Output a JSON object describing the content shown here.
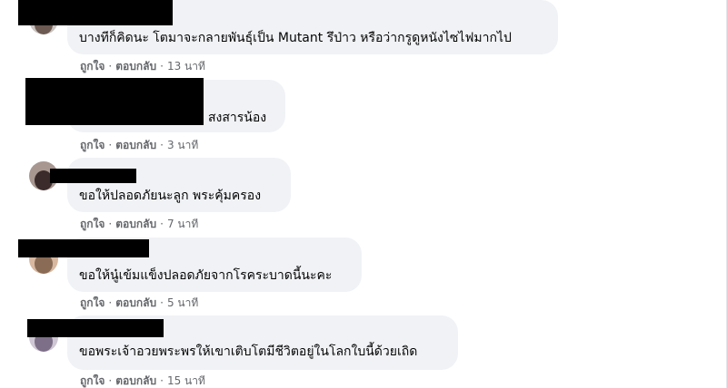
{
  "comments": [
    {
      "text": "บางทีก็คิดนะ โตมาจะกลายพันธุ์เป็น Mutant รึป่าว หรือว่ากรูดูหนังไซไฟมากไป",
      "like_label": "ถูกใจ",
      "reply_label": "ตอบกลับ",
      "time": "13 นาที"
    },
    {
      "text": "สงสารน้อง",
      "like_label": "ถูกใจ",
      "reply_label": "ตอบกลับ",
      "time": "3 นาที"
    },
    {
      "text": "ขอให้ปลอดภัยนะลูก พระคุ้มครอง",
      "like_label": "ถูกใจ",
      "reply_label": "ตอบกลับ",
      "time": "7 นาที"
    },
    {
      "text": "ขอให้นู๋เข้มแข็งปลอดภัยจากโรคระบาดนี้นะคะ",
      "like_label": "ถูกใจ",
      "reply_label": "ตอบกลับ",
      "time": "5 นาที"
    },
    {
      "text": "ขอพระเจ้าอวยพระพรให้เขาเติบโตมีชีวิตอยู่ในโลกใบนี้ด้วยเถิด",
      "like_label": "ถูกใจ",
      "reply_label": "ตอบกลับ",
      "time": "15 นาที"
    }
  ],
  "colors": {
    "bubble": "#f0f2f5",
    "text": "#050505",
    "secondary": "#65676b",
    "redaction": "#000000"
  }
}
